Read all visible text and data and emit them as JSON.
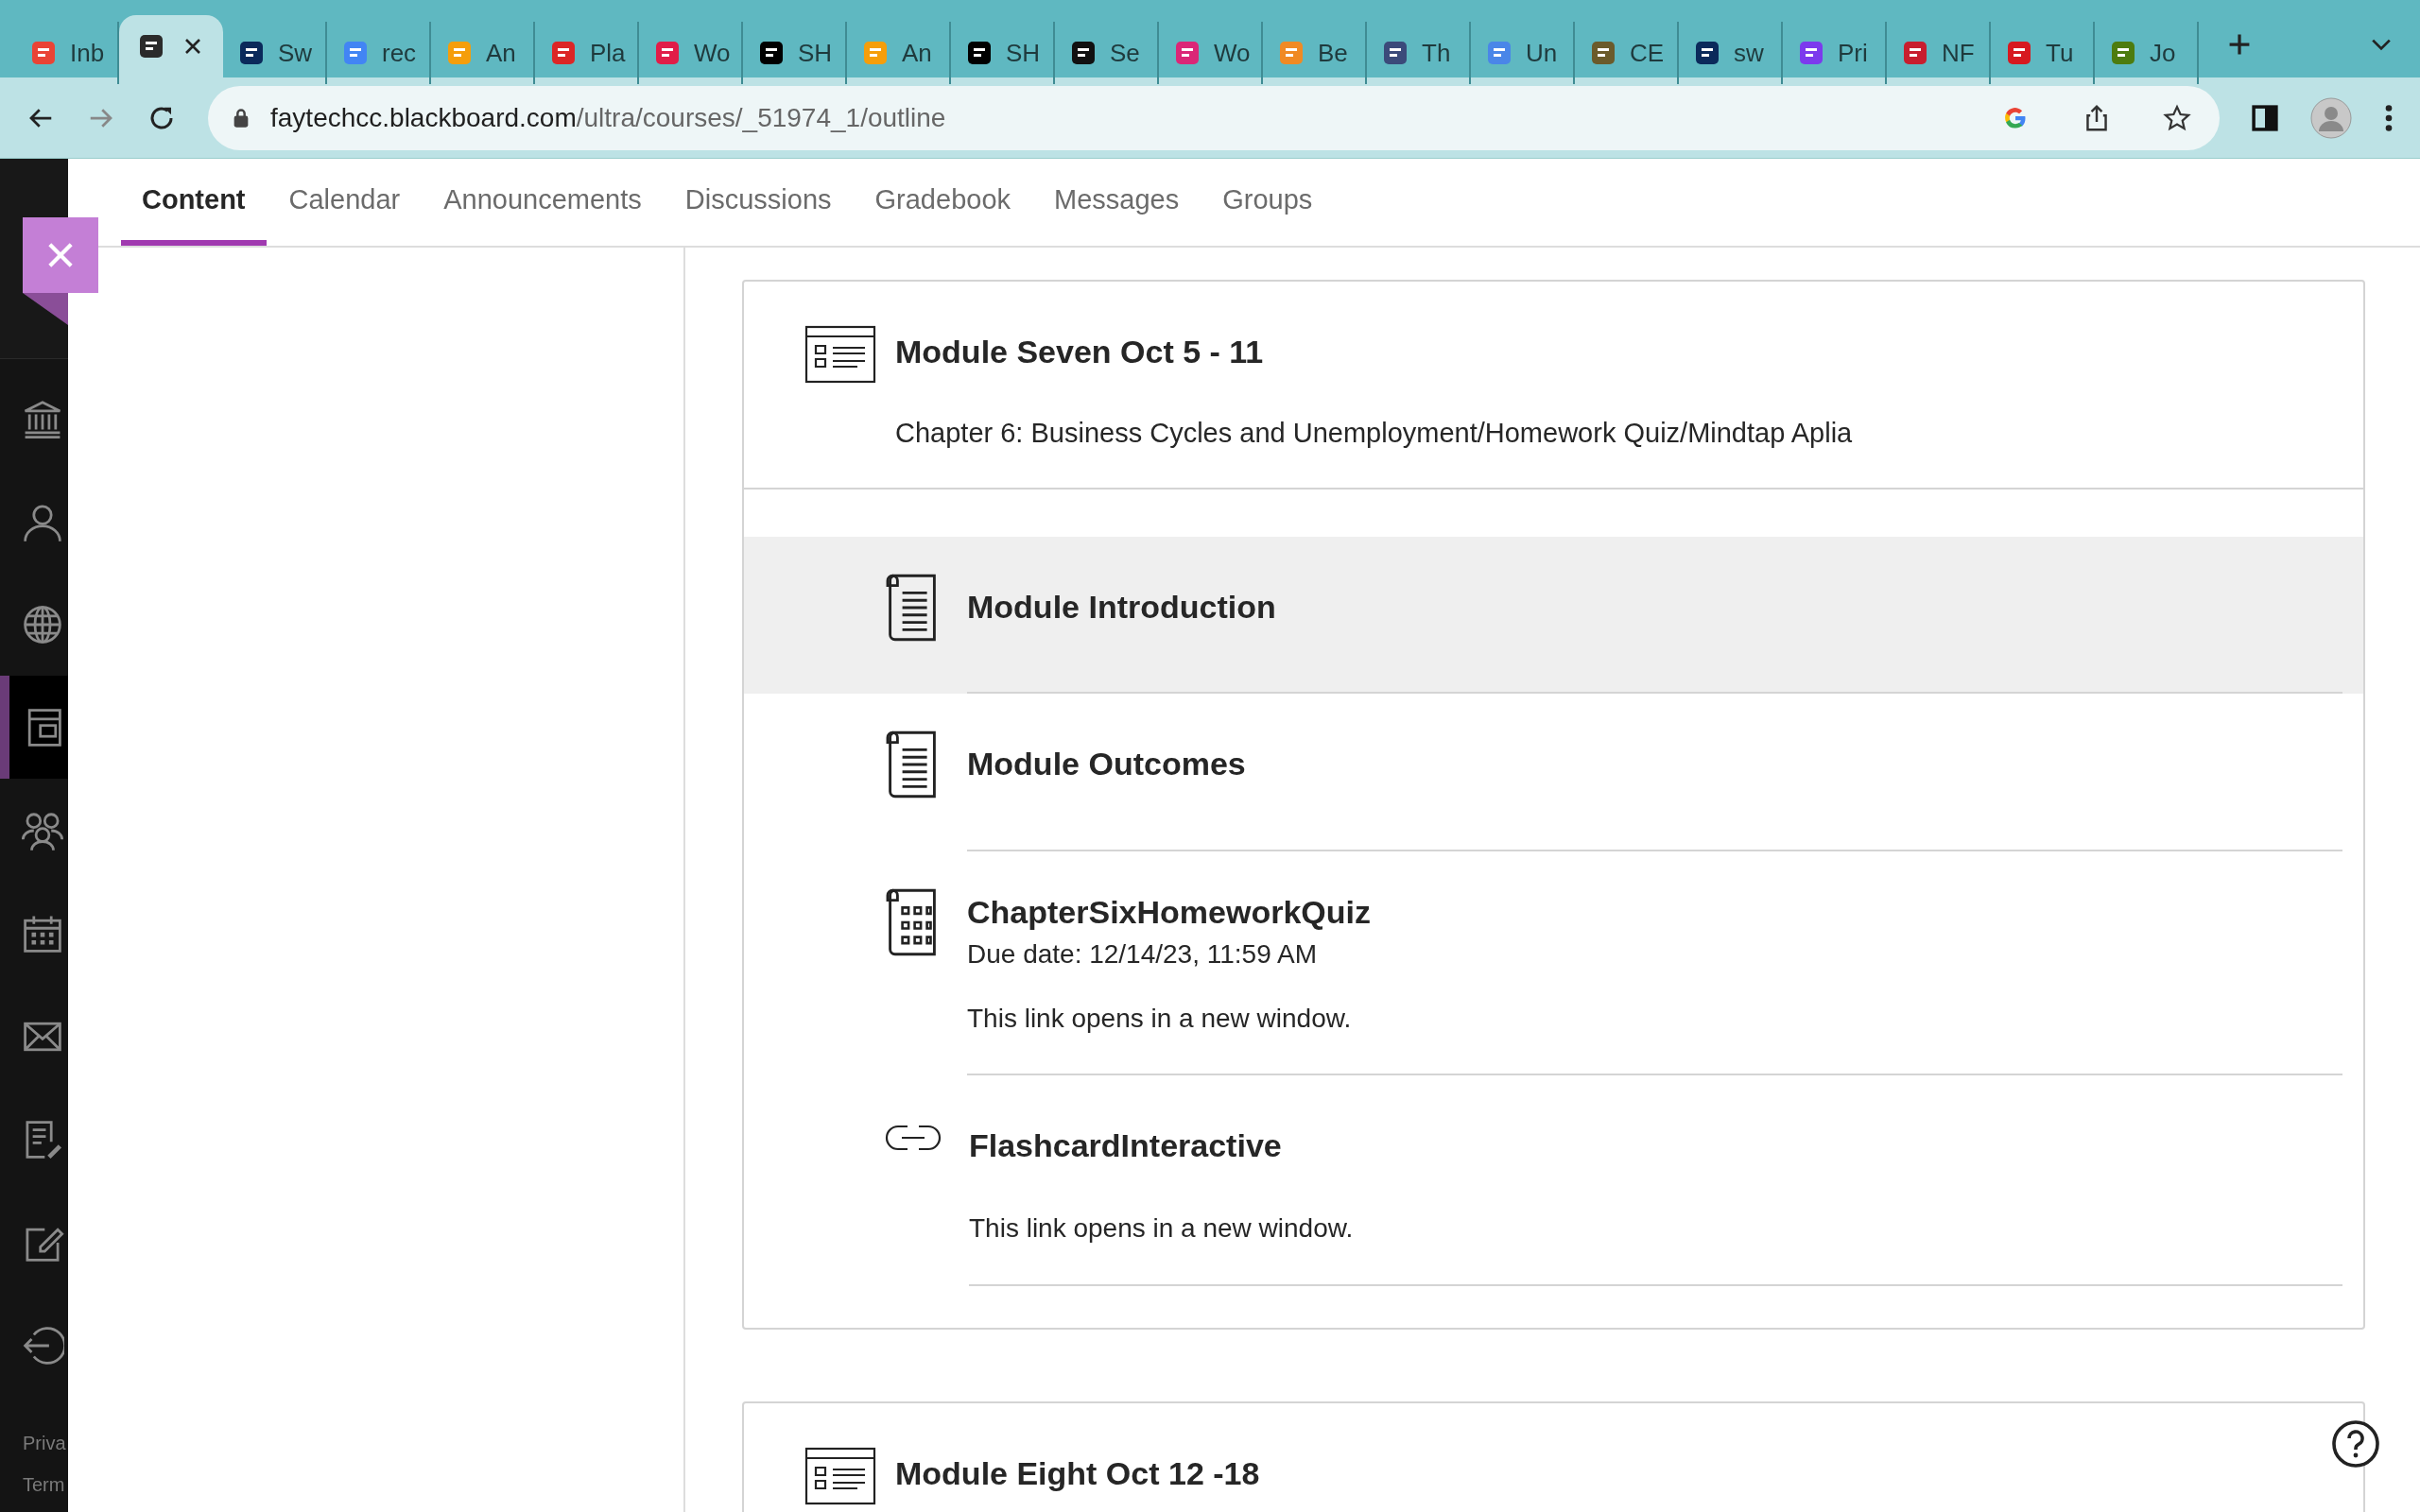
{
  "browser": {
    "tabs": [
      {
        "label": "Inb",
        "selected": false,
        "color": "#ea4335"
      },
      {
        "selected": true,
        "color": "#2b2b2b"
      },
      {
        "label": "Sw",
        "selected": false,
        "color": "#0b2a5b"
      },
      {
        "label": "rec",
        "selected": false,
        "color": "#4285f4"
      },
      {
        "label": "An",
        "selected": false,
        "color": "#f59e0b"
      },
      {
        "label": "Pla",
        "selected": false,
        "color": "#dc2626"
      },
      {
        "label": "Wo",
        "selected": false,
        "color": "#e11d48"
      },
      {
        "label": "SH",
        "selected": false,
        "color": "#000000"
      },
      {
        "label": "An",
        "selected": false,
        "color": "#f59e0b"
      },
      {
        "label": "SH",
        "selected": false,
        "color": "#000000"
      },
      {
        "label": "Se",
        "selected": false,
        "color": "#111111"
      },
      {
        "label": "Wo",
        "selected": false,
        "color": "#db2777"
      },
      {
        "label": "Be",
        "selected": false,
        "color": "#f08a24"
      },
      {
        "label": "Th",
        "selected": false,
        "color": "#3b4a7a"
      },
      {
        "label": "Un",
        "selected": false,
        "color": "#4a86e8"
      },
      {
        "label": "CE",
        "selected": false,
        "color": "#6b5b2b"
      },
      {
        "label": "sw",
        "selected": false,
        "color": "#0b2a5b"
      },
      {
        "label": "Pri",
        "selected": false,
        "color": "#7c3aed"
      },
      {
        "label": "NF",
        "selected": false,
        "color": "#c81e2e"
      },
      {
        "label": "Tu",
        "selected": false,
        "color": "#d71920"
      },
      {
        "label": "Jo",
        "selected": false,
        "color": "#4d7c0f"
      }
    ],
    "url_host": "faytechcc.blackboard.com",
    "url_path": "/ultra/courses/_51974_1/outline"
  },
  "sidebar": {
    "items": [
      {
        "kind": "institution",
        "selected": false
      },
      {
        "kind": "profile",
        "selected": false
      },
      {
        "kind": "globe",
        "selected": false
      },
      {
        "kind": "courses",
        "selected": true
      },
      {
        "kind": "groups",
        "selected": false
      },
      {
        "kind": "calendar",
        "selected": false
      },
      {
        "kind": "messages",
        "selected": false
      },
      {
        "kind": "grades",
        "selected": false
      },
      {
        "kind": "tools",
        "selected": false
      },
      {
        "kind": "signout",
        "selected": false
      }
    ],
    "footer": [
      "Priva",
      "Term"
    ]
  },
  "course_nav": {
    "tabs": [
      {
        "label": "Content",
        "selected": true
      },
      {
        "label": "Calendar",
        "selected": false
      },
      {
        "label": "Announcements",
        "selected": false
      },
      {
        "label": "Discussions",
        "selected": false
      },
      {
        "label": "Gradebook",
        "selected": false
      },
      {
        "label": "Messages",
        "selected": false
      },
      {
        "label": "Groups",
        "selected": false
      }
    ]
  },
  "modules": [
    {
      "title": "Module Seven Oct 5 - 11",
      "description": "Chapter 6: Business Cycles and Unemployment/Homework Quiz/Mindtap Aplia",
      "items": [
        {
          "kind": "document",
          "title": "Module Introduction",
          "selected": true
        },
        {
          "kind": "document",
          "title": "Module Outcomes",
          "selected": false
        },
        {
          "kind": "assessment",
          "title": "ChapterSixHomeworkQuiz",
          "due": "Due date: 12/14/23, 11:59 AM",
          "note": "This link opens in a new window.",
          "selected": false
        },
        {
          "kind": "link",
          "title": "FlashcardInteractive",
          "note": "This link opens in a new window.",
          "selected": false
        }
      ]
    },
    {
      "title": "Module Eight Oct 12 -18"
    }
  ]
}
